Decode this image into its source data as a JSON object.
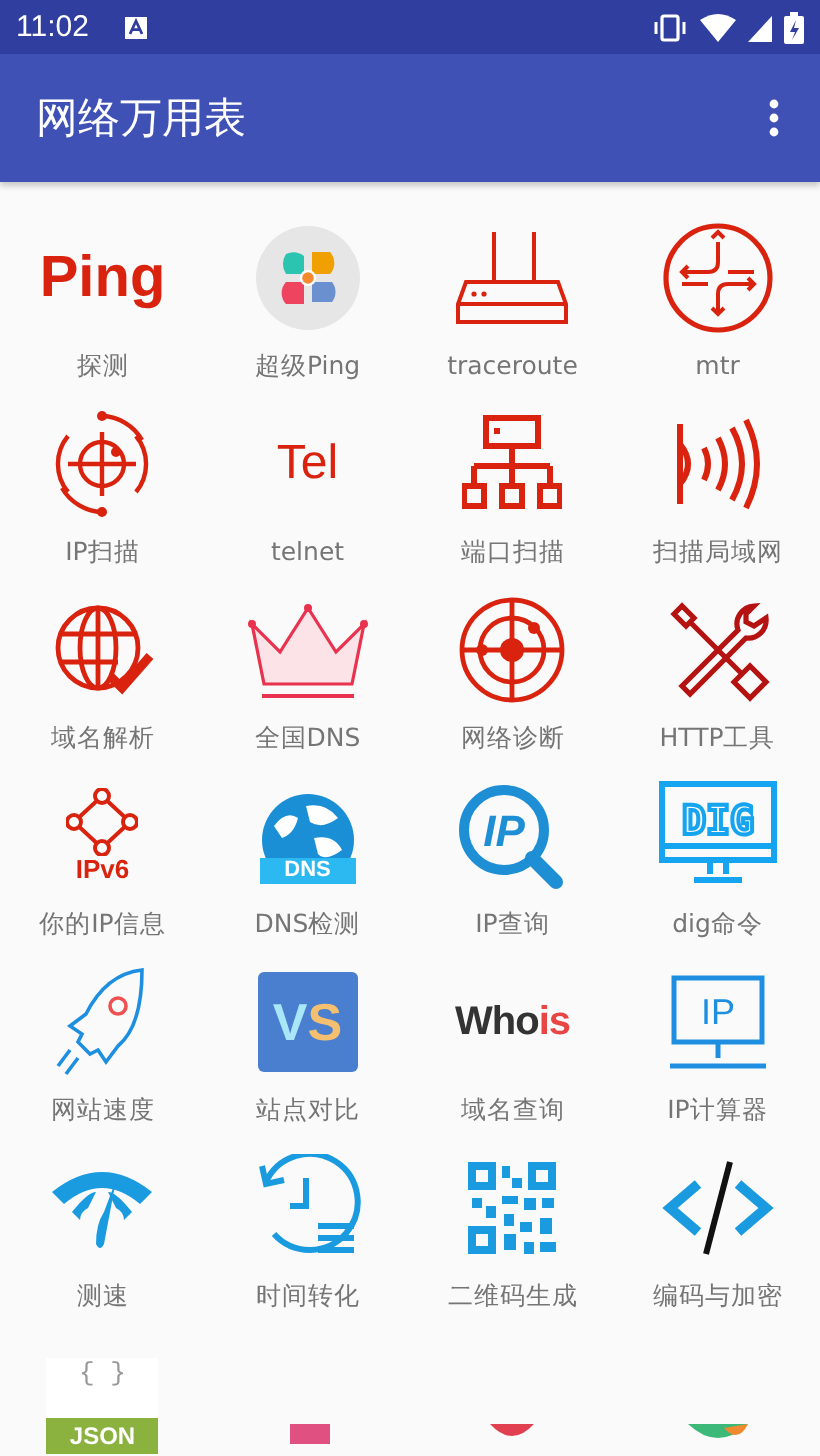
{
  "status_bar": {
    "time": "11:02"
  },
  "app_bar": {
    "title": "网络万用表"
  },
  "tools": [
    {
      "label": "探测",
      "kind": "ping",
      "icon_texts": [
        "Ping"
      ]
    },
    {
      "label": "超级Ping",
      "kind": "petals"
    },
    {
      "label": "traceroute",
      "kind": "router"
    },
    {
      "label": "mtr",
      "kind": "arrows"
    },
    {
      "label": "IP扫描",
      "kind": "target"
    },
    {
      "label": "telnet",
      "kind": "tel",
      "icon_texts": [
        "Tel"
      ]
    },
    {
      "label": "端口扫描",
      "kind": "hierarchy"
    },
    {
      "label": "扫描局域网",
      "kind": "waves"
    },
    {
      "label": "域名解析",
      "kind": "globe-check"
    },
    {
      "label": "全国DNS",
      "kind": "crown"
    },
    {
      "label": "网络诊断",
      "kind": "radar"
    },
    {
      "label": "HTTP工具",
      "kind": "tools"
    },
    {
      "label": "你的IP信息",
      "kind": "ipv6",
      "icon_texts": [
        "IPv6"
      ]
    },
    {
      "label": "DNS检测",
      "kind": "dns-globe",
      "icon_texts": [
        "DNS"
      ]
    },
    {
      "label": "IP查询",
      "kind": "ip-search",
      "icon_texts": [
        "IP"
      ]
    },
    {
      "label": "dig命令",
      "kind": "dig",
      "icon_texts": [
        "DIG"
      ]
    },
    {
      "label": "网站速度",
      "kind": "rocket"
    },
    {
      "label": "站点对比",
      "kind": "vs",
      "icon_texts": [
        "V",
        "S"
      ]
    },
    {
      "label": "域名查询",
      "kind": "whois",
      "icon_texts": [
        "Who",
        "is"
      ]
    },
    {
      "label": "IP计算器",
      "kind": "ip-monitor",
      "icon_texts": [
        "IP"
      ]
    },
    {
      "label": "测速",
      "kind": "gauge"
    },
    {
      "label": "时间转化",
      "kind": "clock"
    },
    {
      "label": "二维码生成",
      "kind": "qr"
    },
    {
      "label": "编码与加密",
      "kind": "code"
    },
    {
      "kind": "json",
      "icon_texts": [
        "{ }",
        "JSON"
      ]
    },
    {
      "kind": "pink-box"
    },
    {
      "kind": "red-shield"
    },
    {
      "kind": "green-orange"
    }
  ]
}
